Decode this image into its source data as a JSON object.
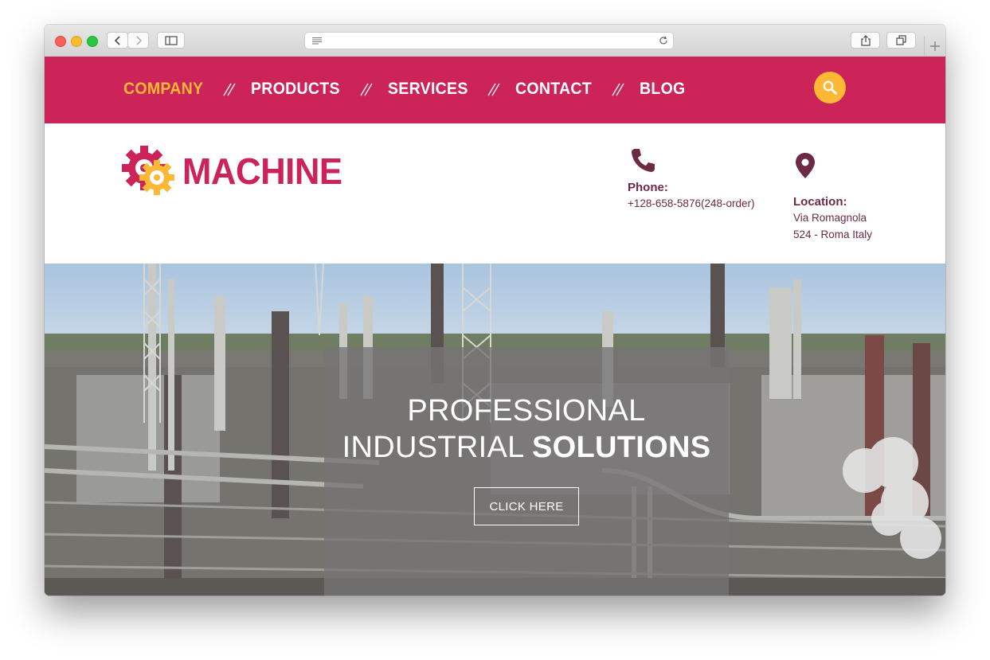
{
  "browser": {
    "url_value": "",
    "controls": [
      "back-icon",
      "forward-icon",
      "sidebar-icon",
      "reader-icon",
      "reload-icon",
      "share-icon",
      "tabs-icon",
      "plus-icon"
    ]
  },
  "nav": {
    "items": [
      {
        "label": "COMPANY",
        "active": true
      },
      {
        "label": "PRODUCTS",
        "active": false
      },
      {
        "label": "SERVICES",
        "active": false
      },
      {
        "label": "CONTACT",
        "active": false
      },
      {
        "label": "BLOG",
        "active": false
      }
    ],
    "search_icon": "search-icon"
  },
  "logo": {
    "text": "MACHINE",
    "icon": "gears-icon"
  },
  "contact": {
    "phone_label": "Phone:",
    "phone_value": "+128-658-5876(248-order)",
    "location_label": "Location:",
    "location_line1": "Via Romagnola",
    "location_line2": "524 - Roma Italy"
  },
  "hero": {
    "title_line1": "PROFESSIONAL",
    "title_line2_regular": "INDUSTRIAL ",
    "title_line2_bold": "SOLUTIONS",
    "button_label": "CLICK HERE"
  },
  "colors": {
    "brand_magenta": "#cc2458",
    "accent_yellow": "#fdb836",
    "info_text": "#6c2a45"
  }
}
